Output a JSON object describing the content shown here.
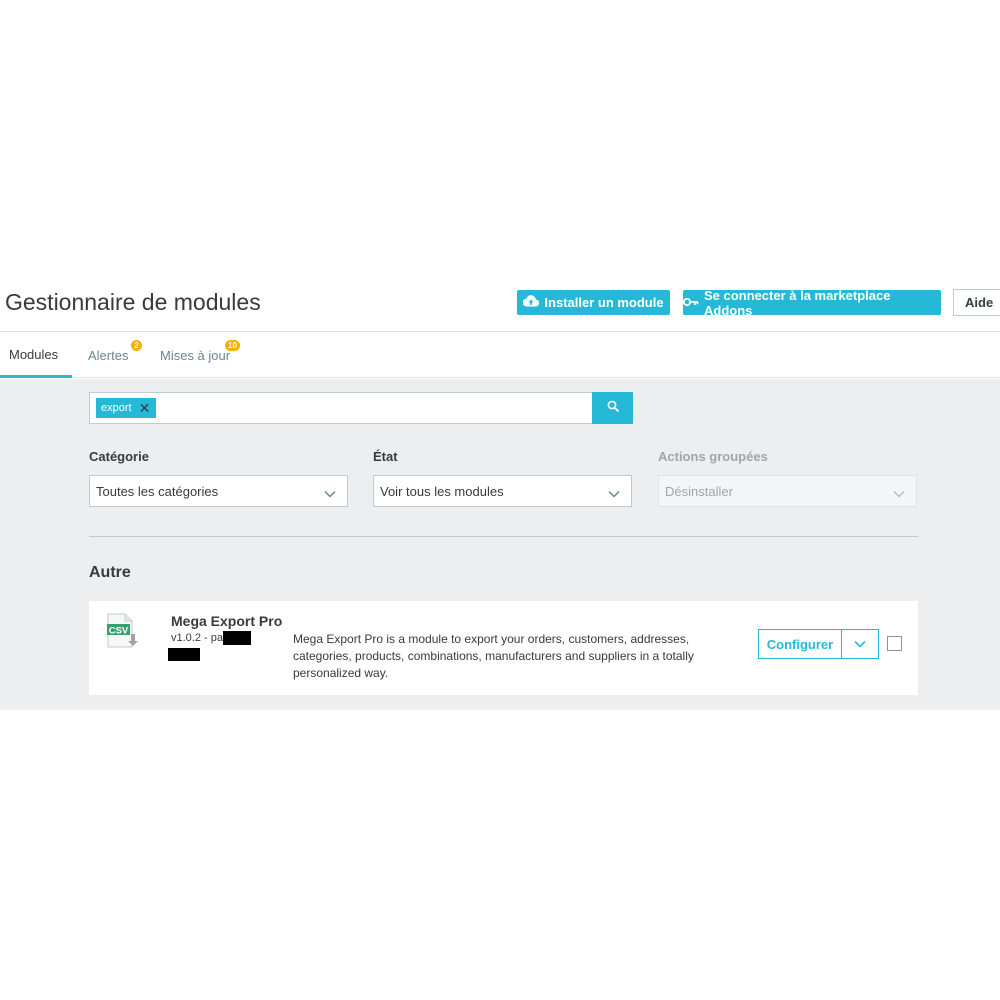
{
  "header": {
    "title": "Gestionnaire de modules",
    "install_label": "Installer un module",
    "addons_label": "Se connecter à la marketplace Addons",
    "help_label": "Aide"
  },
  "tabs": [
    {
      "label": "Modules",
      "active": true
    },
    {
      "label": "Alertes",
      "badge": "2"
    },
    {
      "label": "Mises à jour",
      "badge": "10"
    }
  ],
  "search": {
    "tag": "export"
  },
  "filters": {
    "category": {
      "label": "Catégorie",
      "value": "Toutes les catégories"
    },
    "state": {
      "label": "État",
      "value": "Voir tous les modules"
    },
    "bulk": {
      "label": "Actions groupées",
      "value": "Désinstaller",
      "disabled": true
    }
  },
  "section": {
    "title": "Autre"
  },
  "module": {
    "name": "Mega Export Pro",
    "version": "v1.0.2 - par",
    "description": "Mega Export Pro is a module to export your orders, customers, addresses, categories, products, combinations, manufacturers and suppliers in a totally personalized way.",
    "configure_label": "Configurer",
    "icon_text": "CSV"
  },
  "colors": {
    "accent": "#25b9d7",
    "badge": "#fab000",
    "background": "#eceeef"
  }
}
